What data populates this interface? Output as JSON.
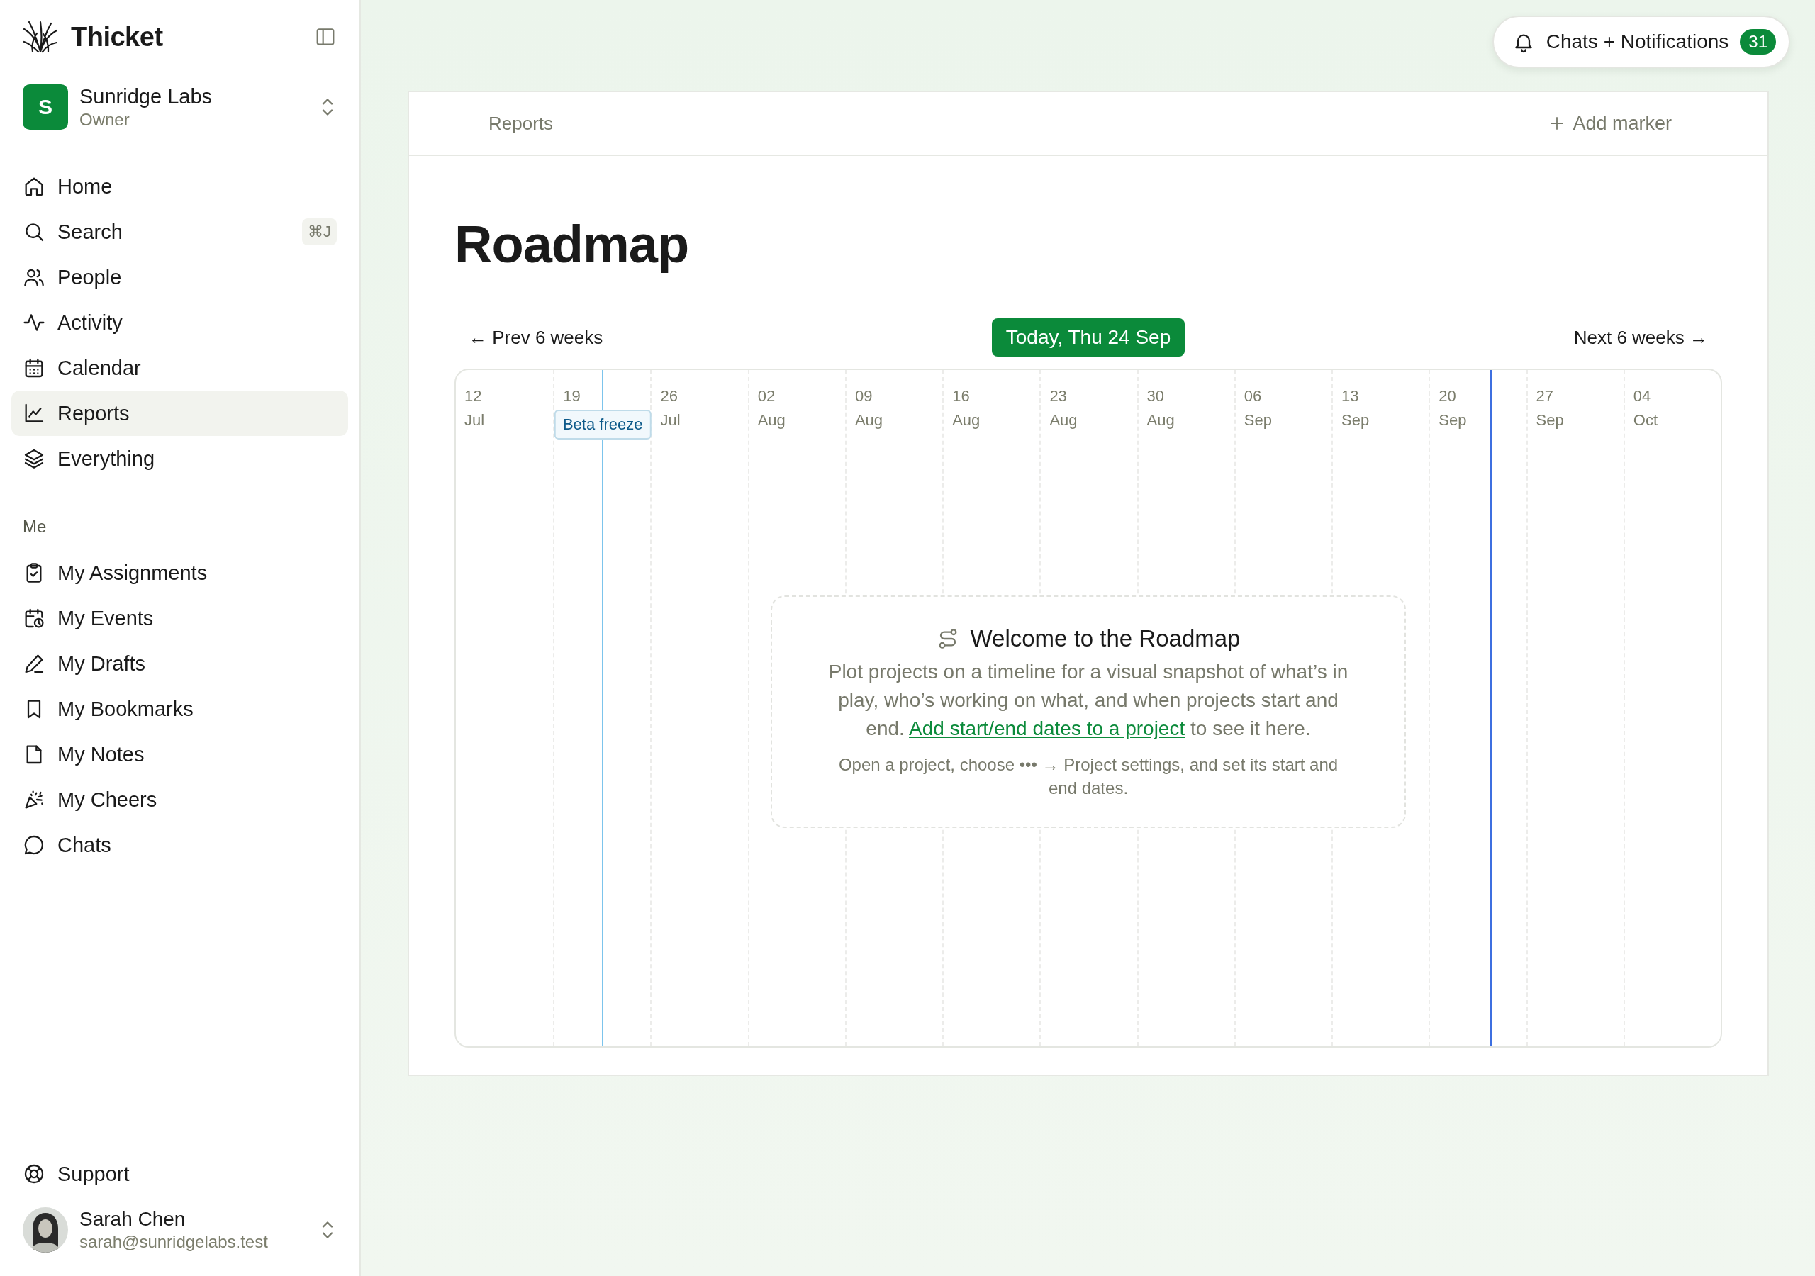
{
  "app": {
    "name": "Thicket"
  },
  "workspace": {
    "initial": "S",
    "name": "Sunridge Labs",
    "role": "Owner"
  },
  "nav": [
    {
      "kind": "home",
      "label": "Home",
      "selected": false
    },
    {
      "kind": "search",
      "label": "Search",
      "shortcut": "⌘J",
      "selected": false
    },
    {
      "kind": "people",
      "label": "People",
      "selected": false
    },
    {
      "kind": "activity",
      "label": "Activity",
      "selected": false
    },
    {
      "kind": "calendar",
      "label": "Calendar",
      "selected": false
    },
    {
      "kind": "chart",
      "label": "Reports",
      "selected": true
    },
    {
      "kind": "layers",
      "label": "Everything",
      "selected": false
    }
  ],
  "me_section": {
    "title": "Me",
    "items": [
      {
        "kind": "clipboard",
        "label": "My Assignments",
        "selected": false
      },
      {
        "kind": "events",
        "label": "My Events",
        "selected": false
      },
      {
        "kind": "pencil",
        "label": "My Drafts",
        "selected": false
      },
      {
        "kind": "bookmark",
        "label": "My Bookmarks",
        "selected": false
      },
      {
        "kind": "note",
        "label": "My Notes",
        "selected": false
      },
      {
        "kind": "party",
        "label": "My Cheers",
        "selected": false
      },
      {
        "kind": "chat",
        "label": "Chats",
        "selected": false
      }
    ]
  },
  "support": {
    "kind": "lifebuoy",
    "label": "Support"
  },
  "user": {
    "name": "Sarah Chen",
    "email": "sarah@sunridgelabs.test"
  },
  "notifications_button": {
    "label": "Chats + Notifications",
    "count": "31"
  },
  "breadcrumb": "Reports",
  "add_marker": {
    "label": "Add marker"
  },
  "title": "Roadmap",
  "timeline": {
    "prev": "← Prev 6 weeks",
    "today": "Today, Thu 24 Sep",
    "next": "Next 6 weeks →",
    "show_today_line": true,
    "weeks": [
      {
        "day": "12",
        "month": "Jul"
      },
      {
        "day": "19"
      },
      {
        "day": "26",
        "month": "Jul"
      },
      {
        "day": "02",
        "month": "Aug"
      },
      {
        "day": "09",
        "month": "Aug"
      },
      {
        "day": "16",
        "month": "Aug"
      },
      {
        "day": "23",
        "month": "Aug"
      },
      {
        "day": "30",
        "month": "Aug"
      },
      {
        "day": "06",
        "month": "Sep"
      },
      {
        "day": "13",
        "month": "Sep"
      },
      {
        "day": "20",
        "month": "Sep"
      },
      {
        "day": "27",
        "month": "Sep"
      },
      {
        "day": "04",
        "month": "Oct"
      }
    ],
    "markers": [
      {
        "kind": "milestone",
        "label": "Beta freeze"
      }
    ]
  },
  "welcome": {
    "title": "Welcome to the Roadmap",
    "body": {
      "before": "Plot projects on a timeline for a visual snapshot of what’s in play, who’s working on what, and when projects start and end. ",
      "link": "Add start/end dates to a project",
      "after": " to see it here."
    },
    "hint": "Open a project, choose ••• → Project settings, and set its start and end dates."
  }
}
